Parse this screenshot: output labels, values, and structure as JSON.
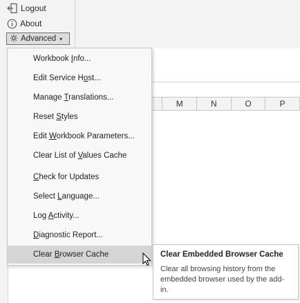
{
  "ribbon": {
    "logout_label": "Logout",
    "about_label": "About",
    "advanced_label": "Advanced"
  },
  "columns": [
    "M",
    "N",
    "O",
    "P"
  ],
  "menu": {
    "items": [
      {
        "pre": "Workbook ",
        "key": "I",
        "post": "nfo..."
      },
      {
        "pre": "Edit Service H",
        "key": "o",
        "post": "st..."
      },
      {
        "pre": "Manage ",
        "key": "T",
        "post": "ranslations..."
      },
      {
        "pre": "Reset ",
        "key": "S",
        "post": "tyles"
      },
      {
        "pre": "Edit ",
        "key": "W",
        "post": "orkbook Parameters..."
      },
      {
        "pre": "Clear List of ",
        "key": "V",
        "post": "alues Cache"
      },
      {
        "pre": "",
        "key": "C",
        "post": "heck for Updates"
      },
      {
        "pre": "Select ",
        "key": "L",
        "post": "anguage..."
      },
      {
        "pre": "Log ",
        "key": "A",
        "post": "ctivity..."
      },
      {
        "pre": "",
        "key": "D",
        "post": "iagnostic Report..."
      },
      {
        "pre": "Clear ",
        "key": "B",
        "post": "rowser Cache"
      }
    ],
    "active_index": 10
  },
  "tooltip": {
    "title": "Clear Embedded Browser Cache",
    "body": "Clear all browsing history from the embedded browser used by the add-in."
  },
  "colors": {
    "ribbon_bg": "#f3f3f3",
    "menu_bg": "#f8f8f8",
    "menu_active": "#d5d5d5",
    "button_border": "#6f6f6f"
  }
}
